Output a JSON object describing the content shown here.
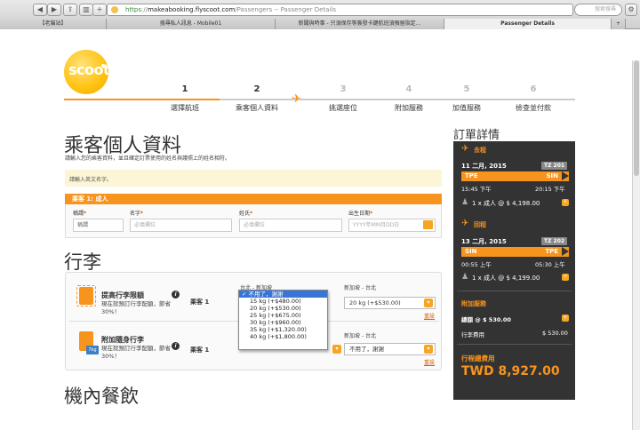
{
  "browser": {
    "url_scheme": "https",
    "url_host": "makeabooking.flyscoot.com",
    "url_rest": "/Passengers -- Passenger Details",
    "search_placeholder": "搜索搜尋",
    "tabs": [
      "【老貓站】",
      "搜尋私人訊息 - Mobile01",
      "新聞與時事 - 只須保存等簽發卡鍵航班須預留指定...",
      "Passenger Details"
    ]
  },
  "brand": {
    "logo_text": "scoot",
    "accent_color": "#f7941d"
  },
  "steps": [
    {
      "num": "1",
      "label": "選擇航班",
      "done": true
    },
    {
      "num": "2",
      "label": "乘客個人資料",
      "done": true
    },
    {
      "num": "3",
      "label": "挑選座位",
      "done": false
    },
    {
      "num": "4",
      "label": "附加服務",
      "done": false
    },
    {
      "num": "5",
      "label": "加值服務",
      "done": false
    },
    {
      "num": "6",
      "label": "檢查並付款",
      "done": false
    }
  ],
  "passenger": {
    "title": "乘客個人資料",
    "subtitle": "請輸入您的乘客資料，並且確定訂票使用的姓名與護照上的姓名相符。",
    "notice": "請輸入英文名字。",
    "bar": "乘客 1: 成人",
    "fields": {
      "title_label": "稱謂",
      "title_value": "稱謂",
      "first_label": "名字",
      "first_placeholder": "必填欄位",
      "last_label": "姓氏",
      "last_placeholder": "必填欄位",
      "dob_label": "出生日期",
      "dob_placeholder": "YYYY年MM月DD日",
      "required_mark": "*"
    }
  },
  "baggage": {
    "title": "行李",
    "items": [
      {
        "name": "提高行李限額",
        "desc": "現在就預訂行李配額，節省30%！",
        "pax": "乘客 1",
        "out_route": "台北 - 新加坡",
        "out_value": "不用了，謝謝",
        "ret_route": "新加坡 - 台北",
        "ret_value": "20 kg (+$530.00)",
        "reset": "重設"
      },
      {
        "name": "附加隨身行李",
        "desc": "現在就預訂行李配額，節省30%！",
        "pax": "乘客 1",
        "ret_route": "新加坡 - 台北",
        "ret_value": "不用了，謝謝",
        "reset": "重設",
        "badge": "7kg"
      }
    ],
    "dropdown": [
      "不用了，謝謝",
      "15 kg (+$480.00)",
      "20 kg (+$530.00)",
      "25 kg (+$675.00)",
      "30 kg (+$960.00)",
      "35 kg (+$1,320.00)",
      "40 kg (+$1,800.00)"
    ]
  },
  "meal": {
    "title": "機內餐飲"
  },
  "summary": {
    "title": "訂單詳情",
    "outbound": {
      "label": "去程",
      "date": "11 二月, 2015",
      "flight": "TZ 201",
      "from": "TPE",
      "to": "SIN",
      "dep": "15:45 下午",
      "arr": "20:15 下午",
      "fare": "1 x 成人 @ $ 4,198.00"
    },
    "inbound": {
      "label": "回程",
      "date": "13 二月, 2015",
      "flight": "TZ 202",
      "from": "SIN",
      "to": "TPE",
      "dep": "00:55 上午",
      "arr": "05:30 上午",
      "fare": "1 x 成人 @ $ 4,199.00"
    },
    "addons_label": "附加服務",
    "bag_line": "總額 @ $ 530.00",
    "bag_fee_label": "行李費用",
    "bag_fee_value": "$ 530.00",
    "total_label": "行程總費用",
    "total_value": "TWD 8,927.00"
  }
}
